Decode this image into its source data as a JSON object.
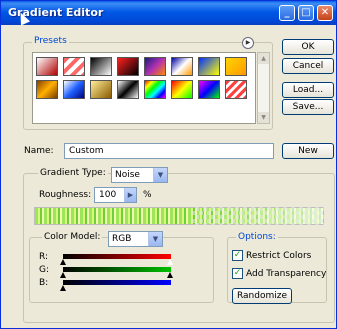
{
  "window": {
    "title": "Gradient Editor",
    "controls": [
      "_",
      "□",
      "✕"
    ]
  },
  "presets": {
    "label": "Presets",
    "menu_icon": "circle-arrow-icon",
    "swatches": [
      {
        "style": "linear-gradient(135deg, #ffffff, #b00000)"
      },
      {
        "style": "repeating-linear-gradient(135deg,#ff6666 0 4px,#ffffff 4px 8px)"
      },
      {
        "style": "linear-gradient(135deg, #000000, #ffffff)"
      },
      {
        "style": "linear-gradient(135deg, #ff2020, #000000)"
      },
      {
        "style": "linear-gradient(135deg, #1a1a80, #b030b0, #ff8a00)"
      },
      {
        "style": "linear-gradient(135deg, #0000a0, #ffffff, #ff9900)"
      },
      {
        "style": "linear-gradient(135deg, #0030ff, #ffff00)"
      },
      {
        "style": "linear-gradient(135deg, #ffd400, #ff9900)"
      },
      {
        "style": "linear-gradient(135deg, #8a4000, #ffb000, #7a3a00)"
      },
      {
        "style": "linear-gradient(135deg, #ffffff, #2060ff, #000080)"
      },
      {
        "style": "linear-gradient(135deg, #ffee99, #8a5a00)"
      },
      {
        "style": "linear-gradient(135deg, #ffffff, #000000, #ffffff)"
      },
      {
        "style": "linear-gradient(135deg, #ff0000, #ffff00, #00ff00, #00ffff, #0000ff, #ff00ff)"
      },
      {
        "style": "linear-gradient(135deg, #ff0000, #ffff00, #00ff00)"
      },
      {
        "style": "linear-gradient(135deg, #ff00ff, #0000ff, #00ff00)"
      },
      {
        "style": "repeating-linear-gradient(135deg,#ff4040 0 3px,#ffffff 3px 6px)"
      }
    ]
  },
  "buttons": {
    "ok": "OK",
    "cancel": "Cancel",
    "load": "Load...",
    "save": "Save...",
    "new": "New",
    "randomize": "Randomize"
  },
  "name_field": {
    "label": "Name:",
    "value": "Custom"
  },
  "gradient_type": {
    "label": "Gradient Type:",
    "value": "Noise"
  },
  "roughness": {
    "label": "Roughness:",
    "value": "100",
    "unit": "%"
  },
  "color_model": {
    "label": "Color Model:",
    "value": "RGB",
    "channels": [
      {
        "label": "R:",
        "gradient": "linear-gradient(90deg, #000000, #ff0000)"
      },
      {
        "label": "G:",
        "gradient": "linear-gradient(90deg, #000000, #00c000)"
      },
      {
        "label": "B:",
        "gradient": "linear-gradient(90deg, #000000, #0000ff)"
      }
    ]
  },
  "options": {
    "label": "Options:",
    "restrict_colors": {
      "label": "Restrict Colors",
      "checked": true
    },
    "add_transparency": {
      "label": "Add Transparency",
      "checked": true
    }
  },
  "colors": {
    "title_bar": "#0058e6",
    "groupbox_label": "#0046d5",
    "dialog_bg": "#ece9d8"
  }
}
